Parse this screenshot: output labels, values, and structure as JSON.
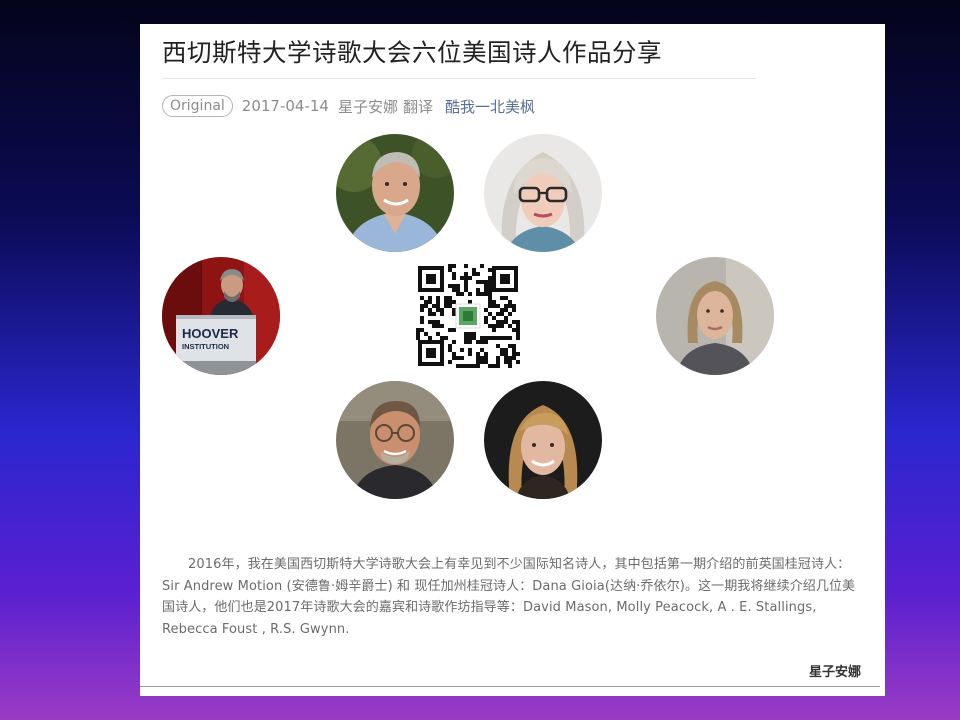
{
  "article": {
    "title": "西切斯特大学诗歌大会六位美国诗人作品分享",
    "badge": "Original",
    "date": "2017-04-14",
    "author": "星子安娜",
    "role": "翻译",
    "account": "酷我一北美枫",
    "paragraph": "2016年，我在美国西切斯特大学诗歌大会上有幸见到不少国际知名诗人，其中包括第一期介绍的前英国桂冠诗人：Sir Andrew Motion (安德鲁·姆辛爵士) 和 现任加州桂冠诗人：Dana Gioia(达纳·乔依尔)。这一期我将继续介绍几位美国诗人，他们也是2017年诗歌大会的嘉宾和诗歌作坊指导等：David  Mason, Molly Peacock, A . E. Stallings, Rebecca Foust , R.S. Gwynn.",
    "signature": "星子安娜"
  },
  "podium": {
    "sign_line1": "HOOVER",
    "sign_line2": "INSTITUTION"
  },
  "colors": {
    "link": "#5a6f96",
    "meta_text": "#8c8c8c",
    "body_text": "#6b6b6b"
  }
}
